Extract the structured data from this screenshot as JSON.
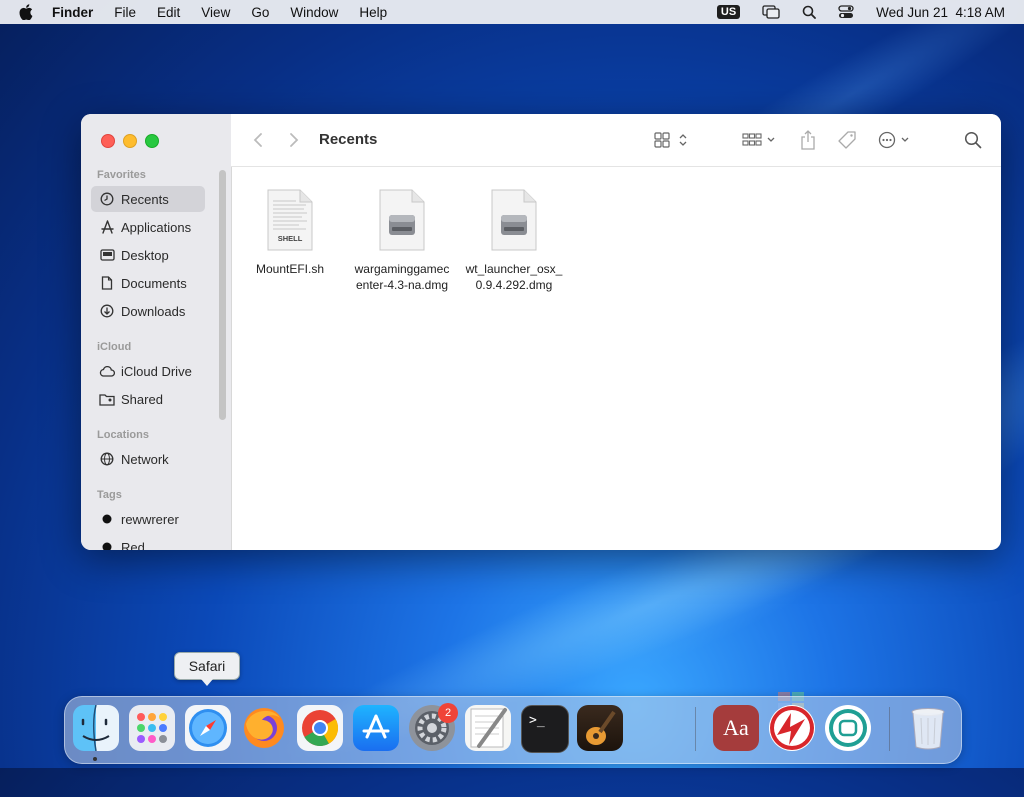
{
  "menubar": {
    "app": "Finder",
    "items": [
      "File",
      "Edit",
      "View",
      "Go",
      "Window",
      "Help"
    ],
    "input_source": "US",
    "clock": "Wed Jun 21  4:18 AM"
  },
  "finder": {
    "title": "Recents",
    "sidebar": {
      "favorites_header": "Favorites",
      "favorites": [
        "Recents",
        "Applications",
        "Desktop",
        "Documents",
        "Downloads"
      ],
      "icloud_header": "iCloud",
      "icloud": [
        "iCloud Drive",
        "Shared"
      ],
      "locations_header": "Locations",
      "locations": [
        "Network"
      ],
      "tags_header": "Tags",
      "tags": [
        "rewwrerer",
        "Red"
      ]
    },
    "files": [
      {
        "name_l1": "MountEFI.sh",
        "name_l2": "",
        "type_label": "SHELL"
      },
      {
        "name_l1": "wargaminggamec",
        "name_l2": "enter-4.3-na.dmg",
        "type_label": ""
      },
      {
        "name_l1": "wt_launcher_osx_",
        "name_l2": "0.9.4.292.dmg",
        "type_label": ""
      }
    ]
  },
  "dock": {
    "tooltip": "Safari",
    "settings_badge": "2",
    "dictionary_label": "Aa",
    "terminal_prompt": ">_"
  }
}
